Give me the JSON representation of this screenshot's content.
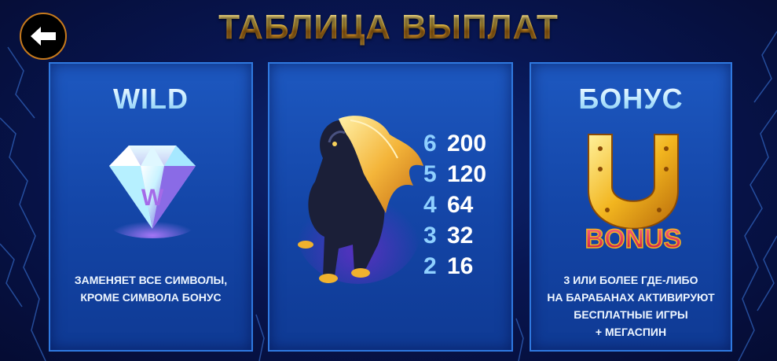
{
  "header": {
    "title": "ТАБЛИЦА ВЫПЛАТ",
    "back_icon": "arrow-left-icon"
  },
  "panels": {
    "wild": {
      "title": "WILD",
      "symbol": "diamond-wild-symbol",
      "symbol_letter": "W",
      "description": [
        "ЗАМЕНЯЕТ ВСЕ СИМВОЛЫ,",
        "КРОМЕ СИМВОЛА БОНУС"
      ]
    },
    "horse": {
      "symbol": "black-horse-symbol",
      "payouts": [
        {
          "count": "6",
          "value": "200"
        },
        {
          "count": "5",
          "value": "120"
        },
        {
          "count": "4",
          "value": "64"
        },
        {
          "count": "3",
          "value": "32"
        },
        {
          "count": "2",
          "value": "16"
        }
      ]
    },
    "bonus": {
      "title": "БОНУС",
      "symbol": "horseshoe-bonus-symbol",
      "symbol_label": "BONUS",
      "description": [
        "3 ИЛИ БОЛЕЕ ГДЕ-ЛИБО",
        "НА БАРАБАНАХ АКТИВИРУЮТ",
        "БЕСПЛАТНЫЕ ИГРЫ",
        "+ МЕГАСПИН"
      ]
    }
  },
  "colors": {
    "title_gold": "#f5c14a",
    "panel_blue": "#1446a8",
    "panel_border": "#2f79e0",
    "count_blue": "#8fd0ff"
  }
}
